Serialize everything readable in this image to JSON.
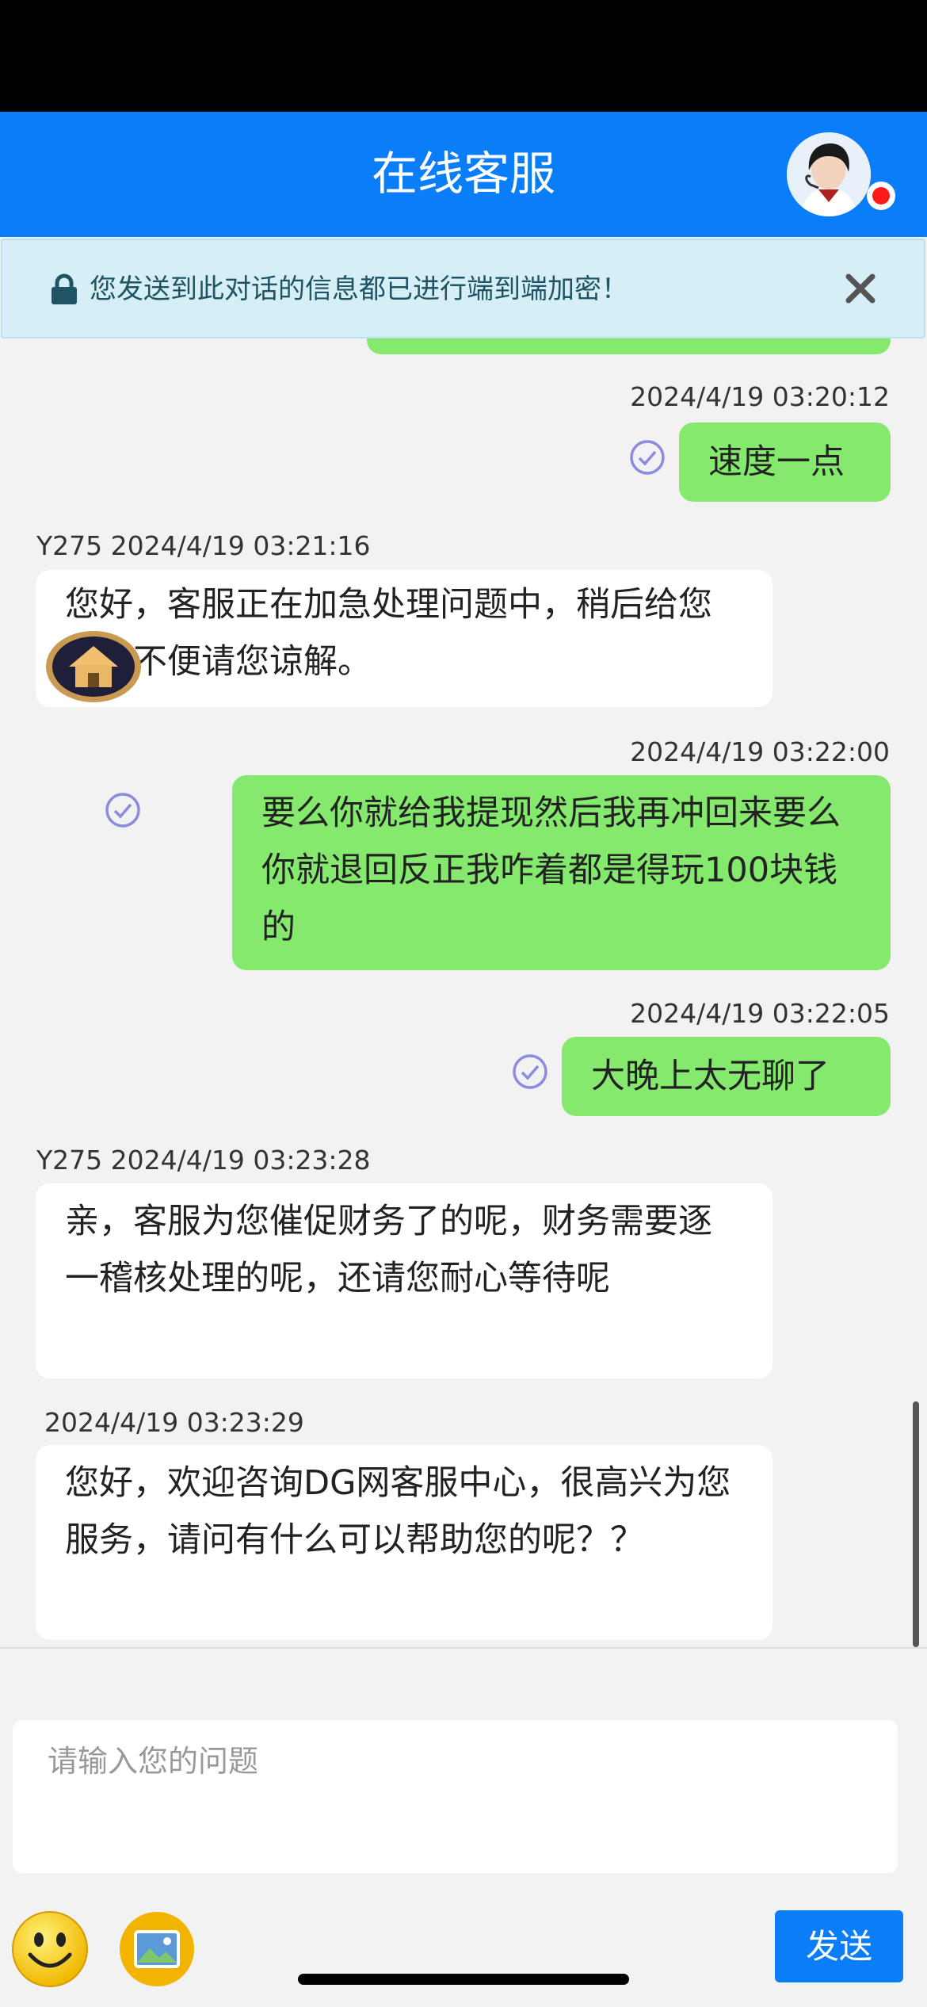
{
  "header": {
    "title": "在线客服"
  },
  "notice": {
    "text": "您发送到此对话的信息都已进行端到端加密！"
  },
  "messages": [
    {
      "timestamp": "2024/4/19 03:20:12",
      "text": "速度一点"
    },
    {
      "timestamp": "Y275 2024/4/19 03:21:16",
      "text": "您好，客服正在加急处理问题中，稍后给您带来不便请您谅解。"
    },
    {
      "timestamp": "2024/4/19 03:22:00",
      "text": "要么你就给我提现然后我再冲回来要么你就退回反正我咋着都是得玩100块钱的"
    },
    {
      "timestamp": "2024/4/19 03:22:05",
      "text": "大晚上太无聊了"
    },
    {
      "timestamp": "Y275 2024/4/19 03:23:28",
      "text": "亲，客服为您催促财务了的呢，财务需要逐一稽核处理的呢，还请您耐心等待呢"
    },
    {
      "timestamp": "2024/4/19 03:23:29",
      "text": "您好，欢迎咨询DG网客服中心，很高兴为您服务，请问有什么可以帮助您的呢？？"
    }
  ],
  "composer": {
    "placeholder": "请输入您的问题",
    "send_label": "发送"
  },
  "icons": {
    "emoji": "smiley-icon",
    "image": "image-icon",
    "lock": "lock-icon",
    "close": "close-icon",
    "read": "check-circle-icon",
    "home_fab": "home-icon"
  },
  "colors": {
    "header": "#0a7df8",
    "outgoing_bubble": "#85e96d",
    "incoming_bubble": "#ffffff",
    "notice_bg": "#d6eef5",
    "online_dot": "#ff1a1a"
  }
}
